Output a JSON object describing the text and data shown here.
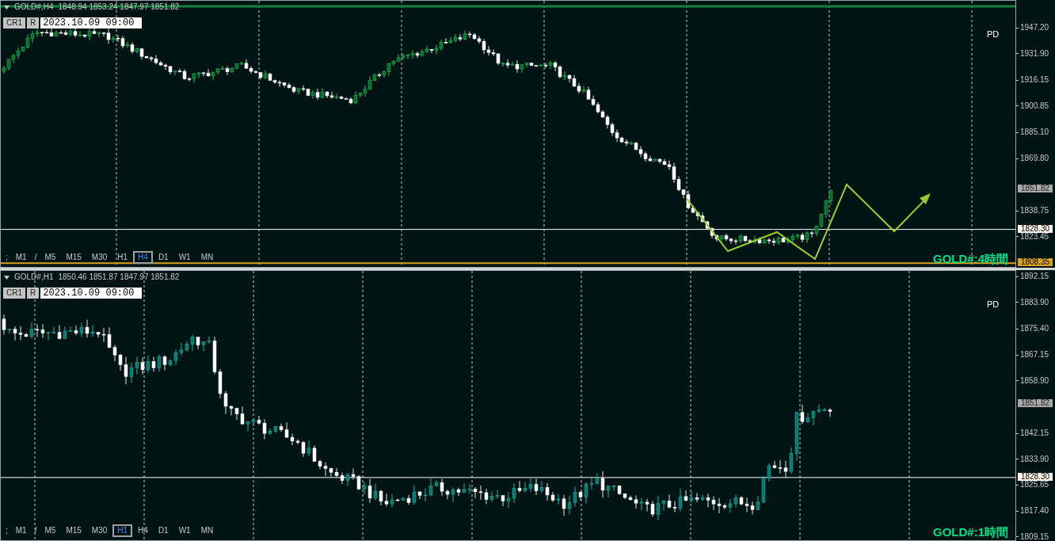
{
  "panels": [
    {
      "symbol": "GOLD#,H4",
      "ohlc": "1848.94 1853.24 1847.97 1851.82",
      "buttons": [
        "CR1",
        "R"
      ],
      "date_field": {
        "value": "2023.10.09 09:00"
      },
      "marker": "PD",
      "chart_title": "GOLD#:4時間",
      "trend_arrow": true,
      "axis_ticks": [
        "1947.20",
        "1931.90",
        "1916.15",
        "1900.85",
        "1885.10",
        "1869.80",
        "1838.75",
        "1823.45"
      ],
      "price_tags": [
        {
          "text": "1851.82",
          "kind": "bid"
        },
        {
          "text": "1828.30",
          "kind": "line"
        },
        {
          "text": "1808.35",
          "kind": "level"
        }
      ],
      "timeframes": [
        {
          "label": ";",
          "kind": "separator",
          "selected": false
        },
        {
          "label": "M1",
          "kind": "tab",
          "selected": false
        },
        {
          "label": "/",
          "kind": "separator",
          "selected": false
        },
        {
          "label": "M5",
          "kind": "tab",
          "selected": false
        },
        {
          "label": "M15",
          "kind": "tab",
          "selected": false
        },
        {
          "label": "M30",
          "kind": "tab",
          "selected": false
        },
        {
          "label": "H1",
          "kind": "tab",
          "selected": false
        },
        {
          "label": "H4",
          "kind": "tab",
          "selected": true
        },
        {
          "label": "D1",
          "kind": "tab",
          "selected": false
        },
        {
          "label": "W1",
          "kind": "tab",
          "selected": false
        },
        {
          "label": "MN",
          "kind": "tab",
          "selected": false
        }
      ]
    },
    {
      "symbol": "GOLD#,H1",
      "ohlc": "1850.46 1851.87 1847.97 1851.82",
      "buttons": [
        "CR1",
        "R"
      ],
      "date_field": {
        "value": "2023.10.09 09:00"
      },
      "marker": "PD",
      "chart_title": "GOLD#:1時間",
      "trend_arrow": false,
      "axis_ticks": [
        "1892.15",
        "1883.90",
        "1875.40",
        "1867.15",
        "1858.90",
        "1842.15",
        "1833.90",
        "1825.65",
        "1817.40",
        "1809.15"
      ],
      "price_tags": [
        {
          "text": "1851.82",
          "kind": "bid"
        },
        {
          "text": "1828.30",
          "kind": "line"
        }
      ],
      "timeframes": [
        {
          "label": ";",
          "kind": "separator",
          "selected": false
        },
        {
          "label": "M1",
          "kind": "tab",
          "selected": false
        },
        {
          "label": "/",
          "kind": "separator",
          "selected": false
        },
        {
          "label": "M5",
          "kind": "tab",
          "selected": false
        },
        {
          "label": "M15",
          "kind": "tab",
          "selected": false
        },
        {
          "label": "M30",
          "kind": "tab",
          "selected": false
        },
        {
          "label": "H1",
          "kind": "tab",
          "selected": true
        },
        {
          "label": "H4",
          "kind": "tab",
          "selected": false
        },
        {
          "label": "D1",
          "kind": "tab",
          "selected": false
        },
        {
          "label": "W1",
          "kind": "tab",
          "selected": false
        },
        {
          "label": "MN",
          "kind": "tab",
          "selected": false
        }
      ]
    }
  ]
}
